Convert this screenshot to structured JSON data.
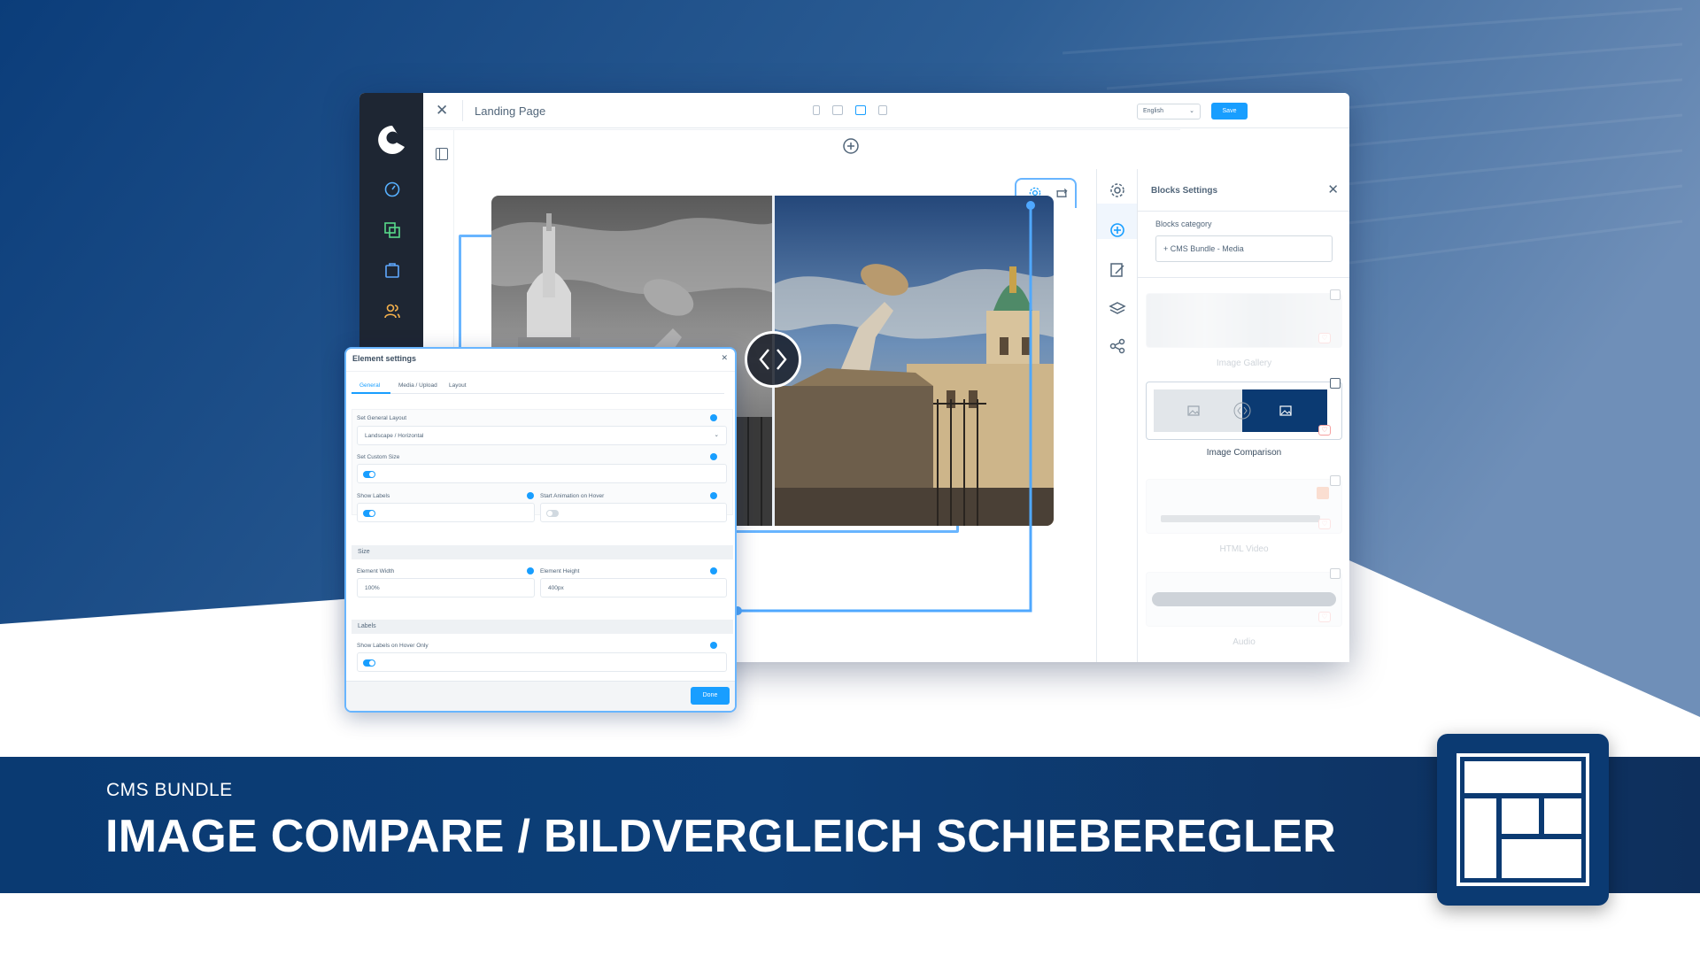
{
  "editor": {
    "page_title": "Landing Page",
    "language": "English",
    "save_label": "Save"
  },
  "blocks_panel": {
    "title": "Blocks Settings",
    "category_label": "Blocks category",
    "category_value": "+ CMS Bundle - Media",
    "blocks": [
      {
        "label": "Image Gallery"
      },
      {
        "label": "Image Comparison"
      },
      {
        "label": "HTML Video"
      },
      {
        "label": "Audio"
      }
    ]
  },
  "element_settings": {
    "title": "Element settings",
    "tabs": [
      "General",
      "Media / Upload",
      "Layout"
    ],
    "active_tab": "General",
    "general_layout_label": "Set General Layout",
    "general_layout_value": "Landscape / Horizontal",
    "custom_size_label": "Set Custom Size",
    "show_labels_label": "Show Labels",
    "start_animation_label": "Start Animation on Hover",
    "size_section": "Size",
    "width_label": "Element Width",
    "width_value": "100%",
    "height_label": "Element Height",
    "height_value": "400px",
    "labels_section": "Labels",
    "hover_labels_label": "Show Labels on Hover Only",
    "toggles": {
      "custom_size": true,
      "show_labels": true,
      "start_animation": false,
      "hover_labels": true
    },
    "done_label": "Done"
  },
  "banner": {
    "subtitle": "CMS BUNDLE",
    "title": "IMAGE COMPARE / BILDVERGLEICH SCHIEBEREGLER"
  },
  "colors": {
    "brand_blue": "#0a3a72",
    "accent": "#189eff",
    "sidebar": "#1e2633"
  },
  "icons": [
    "close-icon",
    "desktop-icon",
    "plus-circle-icon",
    "gear-icon",
    "swap-icon",
    "layers-icon",
    "edit-icon",
    "share-icon",
    "heart-icon",
    "chevron-down-icon",
    "layout-icon"
  ]
}
